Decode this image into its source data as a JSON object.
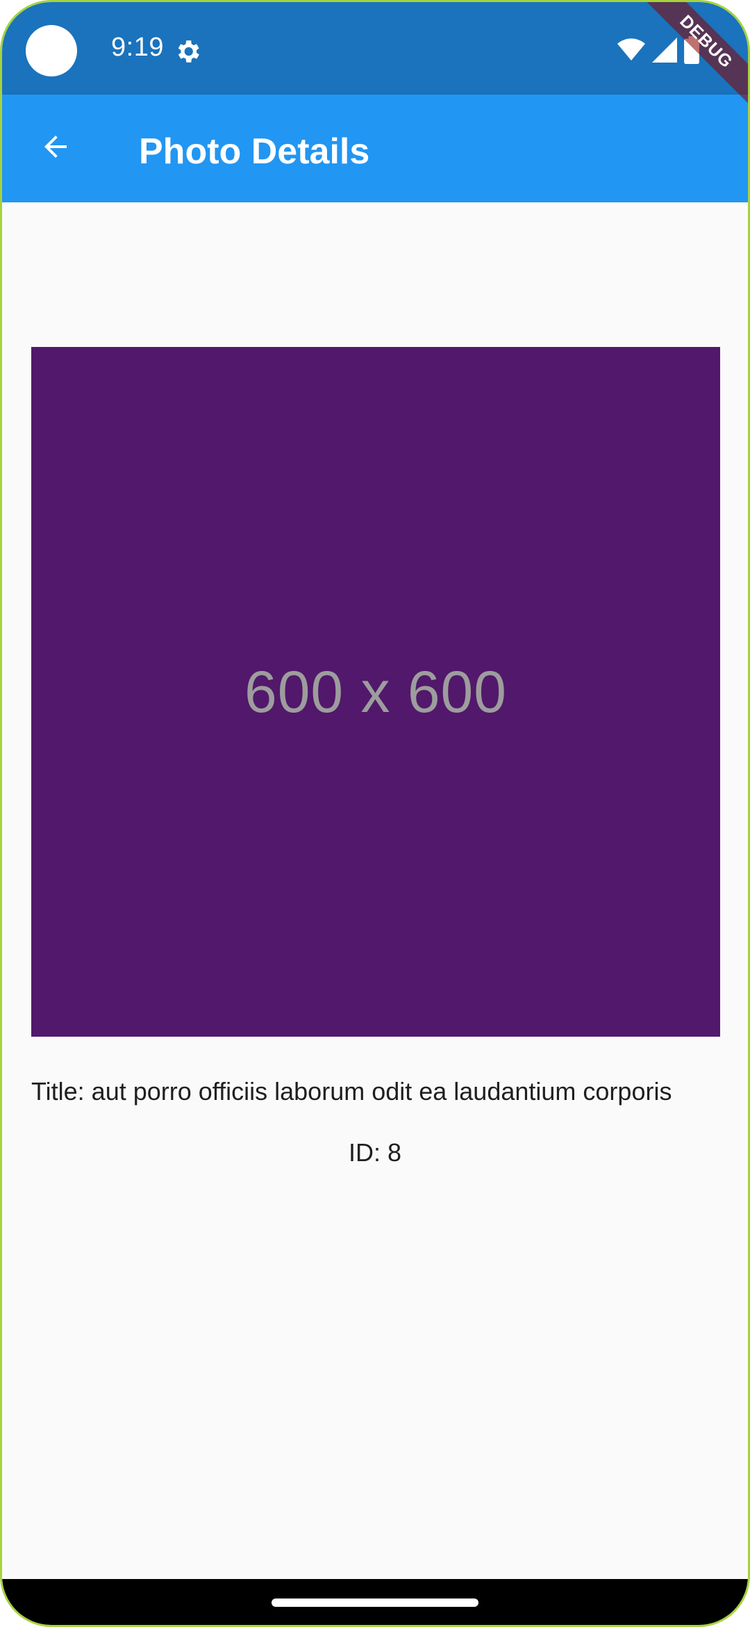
{
  "status_bar": {
    "time": "9:19",
    "icons": [
      "gear-icon",
      "wifi-icon",
      "signal-icon",
      "battery-icon"
    ],
    "color": "#1a73bc"
  },
  "debug_banner": {
    "label": "DEBUG"
  },
  "app_bar": {
    "title": "Photo Details",
    "back_icon": "arrow-back-icon",
    "color": "#2196f3"
  },
  "photo": {
    "placeholder_label": "600 x 600",
    "background": "#52186b",
    "title_text": "Title: aut porro officiis laborum odit ea laudantium corporis",
    "id_text": "ID: 8"
  }
}
